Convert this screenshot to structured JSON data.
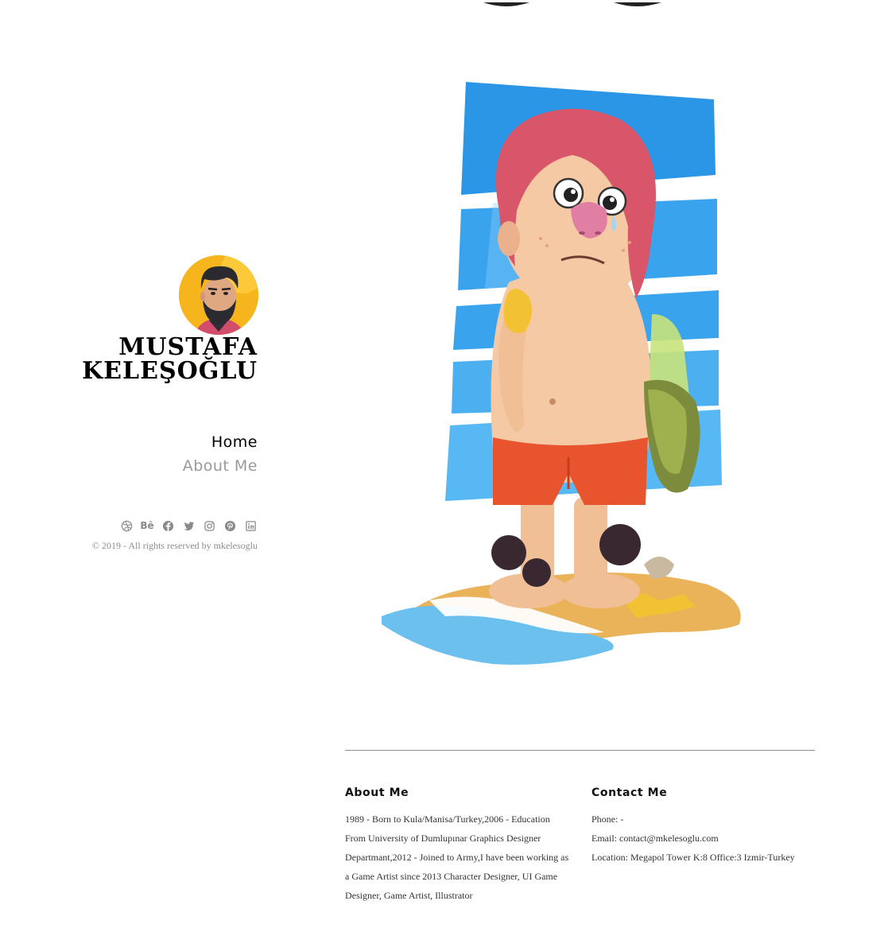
{
  "profile": {
    "name_line1": "MUSTAFA",
    "name_line2": "KELEŞOĞLU",
    "avatar_icon": "avatar-portrait"
  },
  "nav": {
    "items": [
      {
        "label": "Home",
        "active": true
      },
      {
        "label": "About Me",
        "active": false
      }
    ]
  },
  "socials": {
    "icons": [
      "dribbble-icon",
      "behance-icon",
      "facebook-icon",
      "twitter-icon",
      "instagram-icon",
      "pinterest-icon",
      "linkedin-icon"
    ],
    "behance_label": "Bē"
  },
  "footer": {
    "copyright": "© 2019 - All rights reserved by mkelesoglu"
  },
  "about": {
    "heading": "About Me",
    "text": "1989 - Born to Kula/Manisa/Turkey,2006 - Education From University of Dumlupınar Graphics Designer Departmant,2012 - Joined to Army,I have been working as a Game Artist since 2013 Character Designer, UI Game Designer, Game Artist, Illustrator"
  },
  "contact": {
    "heading": "Contact Me",
    "phone": "Phone: -",
    "email": "Email: contact@mkelesoglu.com",
    "location": "Location: Megapol Tower K:8 Office:3 Izmir-Turkey"
  },
  "colors": {
    "muted_nav": "#9a9a9a",
    "social_icon": "#8a8a8a",
    "avatar_bg": "#f6b41d",
    "art_blue": "#2f9ee8",
    "art_skin": "#f4c9a3",
    "art_hair": "#d9566a",
    "art_shorts": "#e8542e",
    "art_sand": "#eab35a"
  }
}
